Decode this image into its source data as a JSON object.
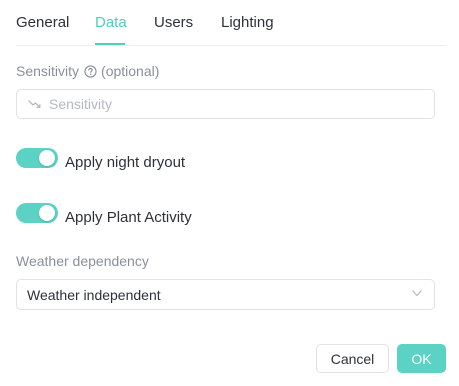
{
  "tabs": [
    {
      "label": "General",
      "active": false
    },
    {
      "label": "Data",
      "active": true
    },
    {
      "label": "Users",
      "active": false
    },
    {
      "label": "Lighting",
      "active": false
    }
  ],
  "sensitivity": {
    "label": "Sensitivity",
    "optional_text": "(optional)",
    "placeholder": "Sensitivity",
    "value": ""
  },
  "toggles": [
    {
      "label": "Apply night dryout",
      "checked": true
    },
    {
      "label": "Apply Plant Activity",
      "checked": true
    }
  ],
  "weather": {
    "label": "Weather dependency",
    "selected": "Weather independent"
  },
  "actions": {
    "cancel_label": "Cancel",
    "ok_label": "OK"
  },
  "colors": {
    "accent": "#5bd2c3",
    "text": "#2d3139",
    "muted": "#8a8f99"
  }
}
